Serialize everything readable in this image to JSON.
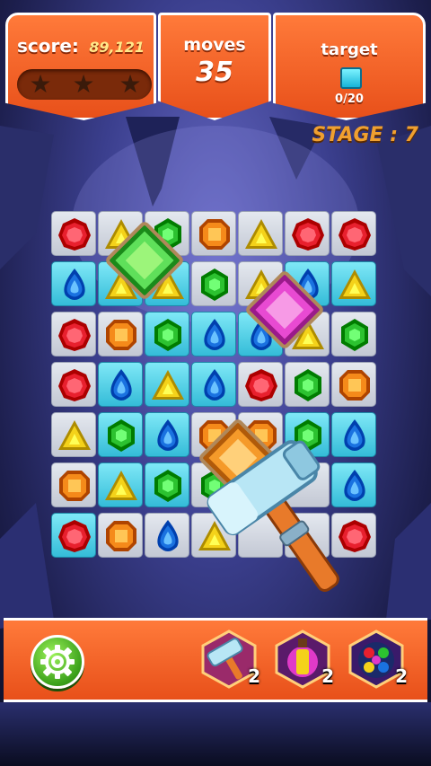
{
  "hud": {
    "score_label": "score:",
    "score_value": "89,121",
    "stars_earned": 0,
    "stars_total": 3,
    "moves_label": "moves",
    "moves_value": "35",
    "target_label": "target",
    "target_count": "0/20",
    "target_gem_color": "#3fd3ee",
    "stage_label": "STAGE : 7"
  },
  "board": {
    "rows": 7,
    "cols": 7,
    "tiles": [
      [
        0,
        0,
        0,
        0,
        0,
        0,
        0
      ],
      [
        1,
        1,
        1,
        0,
        0,
        1,
        1
      ],
      [
        0,
        0,
        1,
        1,
        1,
        0,
        0
      ],
      [
        0,
        1,
        1,
        1,
        0,
        0,
        0
      ],
      [
        0,
        1,
        1,
        0,
        0,
        1,
        1
      ],
      [
        0,
        1,
        1,
        0,
        0,
        0,
        1
      ],
      [
        1,
        0,
        0,
        0,
        0,
        0,
        0
      ]
    ],
    "gems": [
      [
        "red",
        "yellow",
        "green",
        "orange",
        "yellow",
        "red",
        "red"
      ],
      [
        "blue",
        "yellow",
        "yellow",
        "green",
        "yellow",
        "blue",
        "yellow"
      ],
      [
        "red",
        "orange",
        "green",
        "blue",
        "blue",
        "yellow",
        "green"
      ],
      [
        "red",
        "blue",
        "yellow",
        "blue",
        "red",
        "green",
        "orange"
      ],
      [
        "yellow",
        "green",
        "blue",
        "orange",
        "orange",
        "green",
        "blue"
      ],
      [
        "orange",
        "yellow",
        "green",
        "green",
        "",
        "",
        "blue"
      ],
      [
        "red",
        "orange",
        "blue",
        "yellow",
        "",
        "",
        "red"
      ]
    ],
    "special_gems": [
      {
        "name": "big-green-gem",
        "color": "green"
      },
      {
        "name": "big-pink-gem",
        "color": "pink"
      },
      {
        "name": "big-orange-gem",
        "color": "orange"
      }
    ]
  },
  "gem_colors": {
    "red": "#e8202e",
    "blue": "#1a72e0",
    "green": "#2cc230",
    "yellow": "#f4d21a",
    "orange": "#f58a1a",
    "pink": "#e03ac8"
  },
  "boosters": [
    {
      "name": "hammer-booster",
      "icon": "hammer-icon",
      "count": "2"
    },
    {
      "name": "bomb-booster",
      "icon": "bomb-icon",
      "count": "2"
    },
    {
      "name": "color-ball-booster",
      "icon": "gem-ball-icon",
      "count": "2"
    }
  ],
  "settings_icon": "gear-icon"
}
